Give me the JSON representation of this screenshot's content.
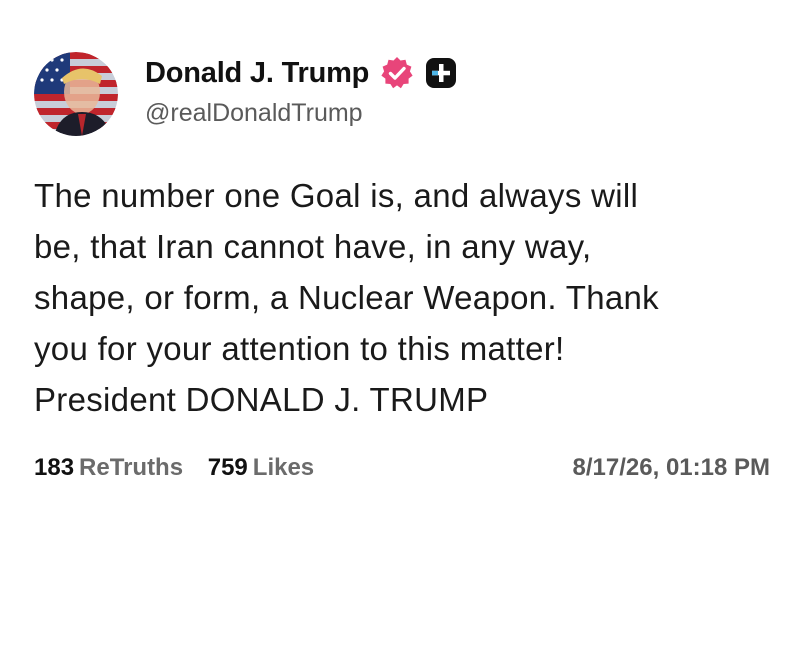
{
  "author": {
    "display_name": "Donald J. Trump",
    "handle": "@realDonaldTrump",
    "verified_badge_icon": "verified-badge-icon",
    "verified_color": "#e8457a",
    "subscribe_icon": "plus-icon",
    "avatar_icon": "profile-avatar"
  },
  "post": {
    "lines": [
      "The number one Goal is, and always will",
      "be, that Iran cannot have, in any way,",
      "shape, or form, a Nuclear Weapon. Thank",
      "you for your attention to this matter!",
      "President DONALD J. TRUMP"
    ]
  },
  "footer": {
    "retruths_count": "183",
    "retruths_label": "ReTruths",
    "likes_count": "759",
    "likes_label": "Likes",
    "timestamp": "8/17/26, 01:18 PM"
  }
}
